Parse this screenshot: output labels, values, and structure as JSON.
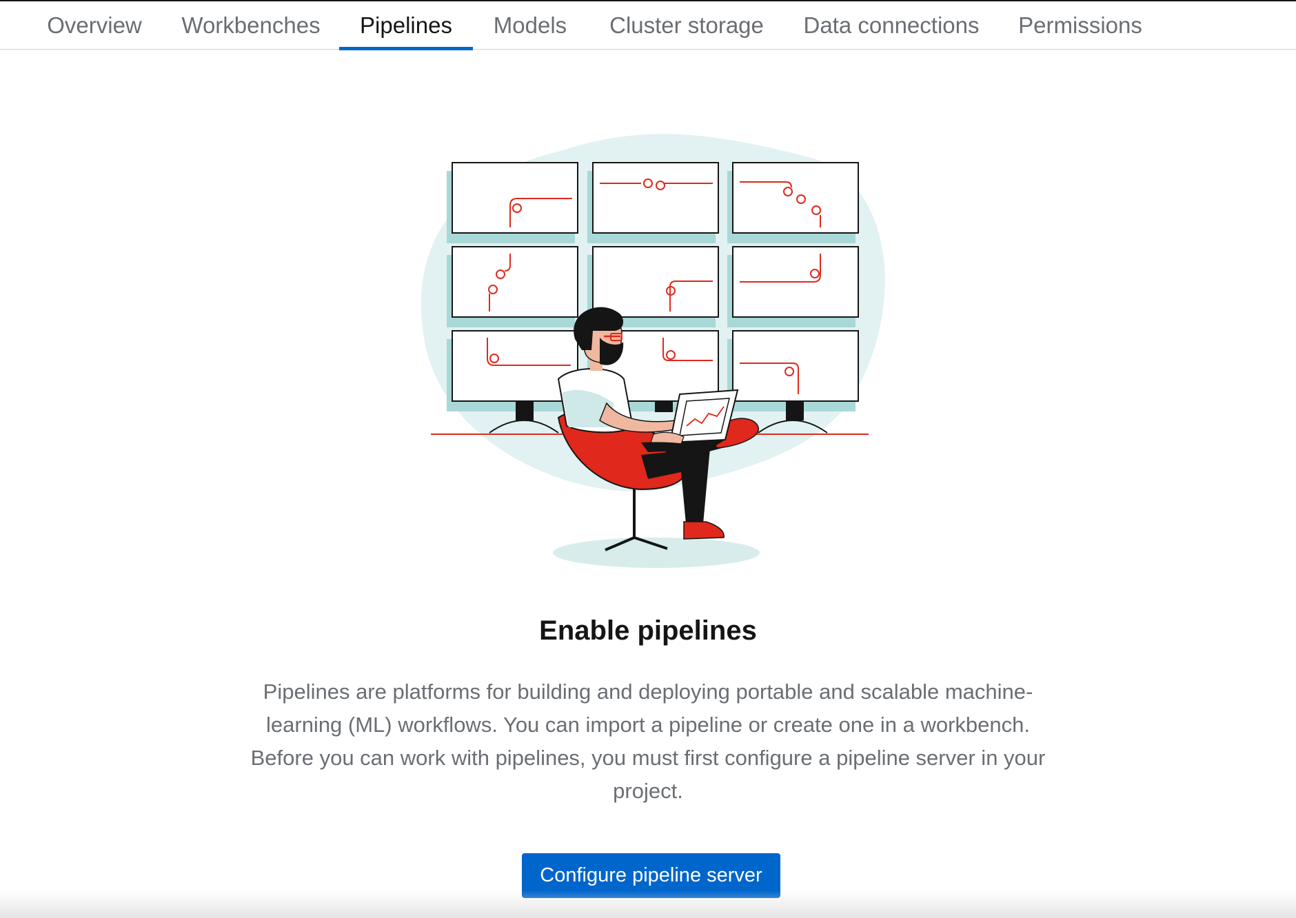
{
  "tabs": [
    {
      "label": "Overview",
      "active": false
    },
    {
      "label": "Workbenches",
      "active": false
    },
    {
      "label": "Pipelines",
      "active": true
    },
    {
      "label": "Models",
      "active": false
    },
    {
      "label": "Cluster storage",
      "active": false
    },
    {
      "label": "Data connections",
      "active": false
    },
    {
      "label": "Permissions",
      "active": false
    }
  ],
  "empty_state": {
    "illustration": "person-with-laptop-monitoring-pipeline-screens",
    "title": "Enable pipelines",
    "description": "Pipelines are platforms for building and deploying portable and scalable machine-learning (ML) workflows. You can import a pipeline or create one in a workbench. Before you can work with pipelines, you must first configure a pipeline server in your project.",
    "button_label": "Configure pipeline server"
  },
  "colors": {
    "accent": "#0066cc",
    "illustration_red": "#e0281c",
    "illustration_teal": "#cfe8e8",
    "text_muted": "#6a6e73",
    "text_dark": "#151515"
  }
}
